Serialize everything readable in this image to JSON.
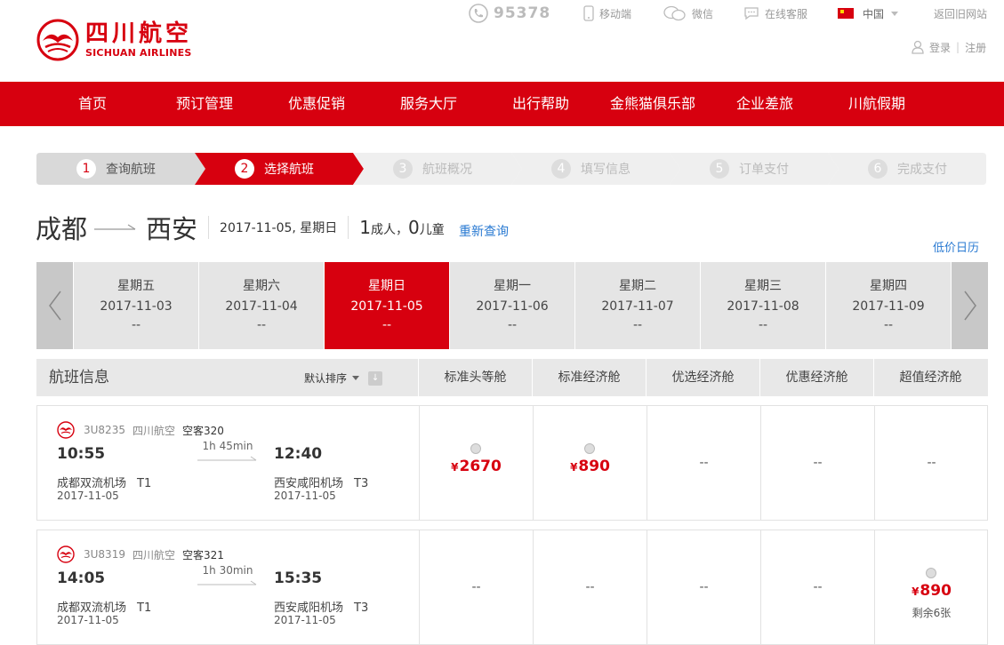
{
  "brand": {
    "name_cn": "四川航空",
    "name_en": "SICHUAN AIRLINES",
    "color": "#d7000f"
  },
  "toplinks": {
    "phone": "95378",
    "mobile": "移动端",
    "wechat": "微信",
    "service": "在线客服",
    "region": "中国",
    "old_site": "返回旧网站",
    "login": "登录",
    "register": "注册"
  },
  "nav": [
    "首页",
    "预订管理",
    "优惠促销",
    "服务大厅",
    "出行帮助",
    "金熊猫俱乐部",
    "企业差旅",
    "川航假期"
  ],
  "steps": [
    {
      "num": "1",
      "label": "查询航班",
      "state": "done"
    },
    {
      "num": "2",
      "label": "选择航班",
      "state": "active"
    },
    {
      "num": "3",
      "label": "航班概况",
      "state": "todo"
    },
    {
      "num": "4",
      "label": "填写信息",
      "state": "todo"
    },
    {
      "num": "5",
      "label": "订单支付",
      "state": "todo"
    },
    {
      "num": "6",
      "label": "完成支付",
      "state": "todo"
    }
  ],
  "route": {
    "from": "成都",
    "to": "西安",
    "date": "2017-11-05, 星期日",
    "adults": "1",
    "adults_label": "成人，",
    "children": "0",
    "children_label": "儿童",
    "requery": "重新查询",
    "low_price_calendar": "低价日历"
  },
  "dates": [
    {
      "weekday": "星期五",
      "date": "2017-11-03",
      "price": "--"
    },
    {
      "weekday": "星期六",
      "date": "2017-11-04",
      "price": "--"
    },
    {
      "weekday": "星期日",
      "date": "2017-11-05",
      "price": "--",
      "active": true
    },
    {
      "weekday": "星期一",
      "date": "2017-11-06",
      "price": "--"
    },
    {
      "weekday": "星期二",
      "date": "2017-11-07",
      "price": "--"
    },
    {
      "weekday": "星期三",
      "date": "2017-11-08",
      "price": "--"
    },
    {
      "weekday": "星期四",
      "date": "2017-11-09",
      "price": "--"
    }
  ],
  "table": {
    "title": "航班信息",
    "sort": "默认排序",
    "columns": [
      "标准头等舱",
      "标准经济舱",
      "优选经济舱",
      "优惠经济舱",
      "超值经济舱"
    ]
  },
  "flights": [
    {
      "number": "3U8235",
      "airline": "四川航空",
      "aircraft": "空客320",
      "dep_time": "10:55",
      "arr_time": "12:40",
      "duration": "1h 45min",
      "dep_airport": "成都双流机场",
      "dep_terminal": "T1",
      "arr_airport": "西安咸阳机场",
      "arr_terminal": "T3",
      "dep_date": "2017-11-05",
      "arr_date": "2017-11-05",
      "fares": [
        {
          "price": "2670",
          "currency": "¥"
        },
        {
          "price": "890",
          "currency": "¥"
        },
        {
          "dash": "--"
        },
        {
          "dash": "--"
        },
        {
          "dash": "--"
        }
      ]
    },
    {
      "number": "3U8319",
      "airline": "四川航空",
      "aircraft": "空客321",
      "dep_time": "14:05",
      "arr_time": "15:35",
      "duration": "1h 30min",
      "dep_airport": "成都双流机场",
      "dep_terminal": "T1",
      "arr_airport": "西安咸阳机场",
      "arr_terminal": "T3",
      "dep_date": "2017-11-05",
      "arr_date": "2017-11-05",
      "fares": [
        {
          "dash": "--"
        },
        {
          "dash": "--"
        },
        {
          "dash": "--"
        },
        {
          "dash": "--"
        },
        {
          "price": "890",
          "currency": "¥",
          "remain": "剩余6张"
        }
      ]
    }
  ]
}
